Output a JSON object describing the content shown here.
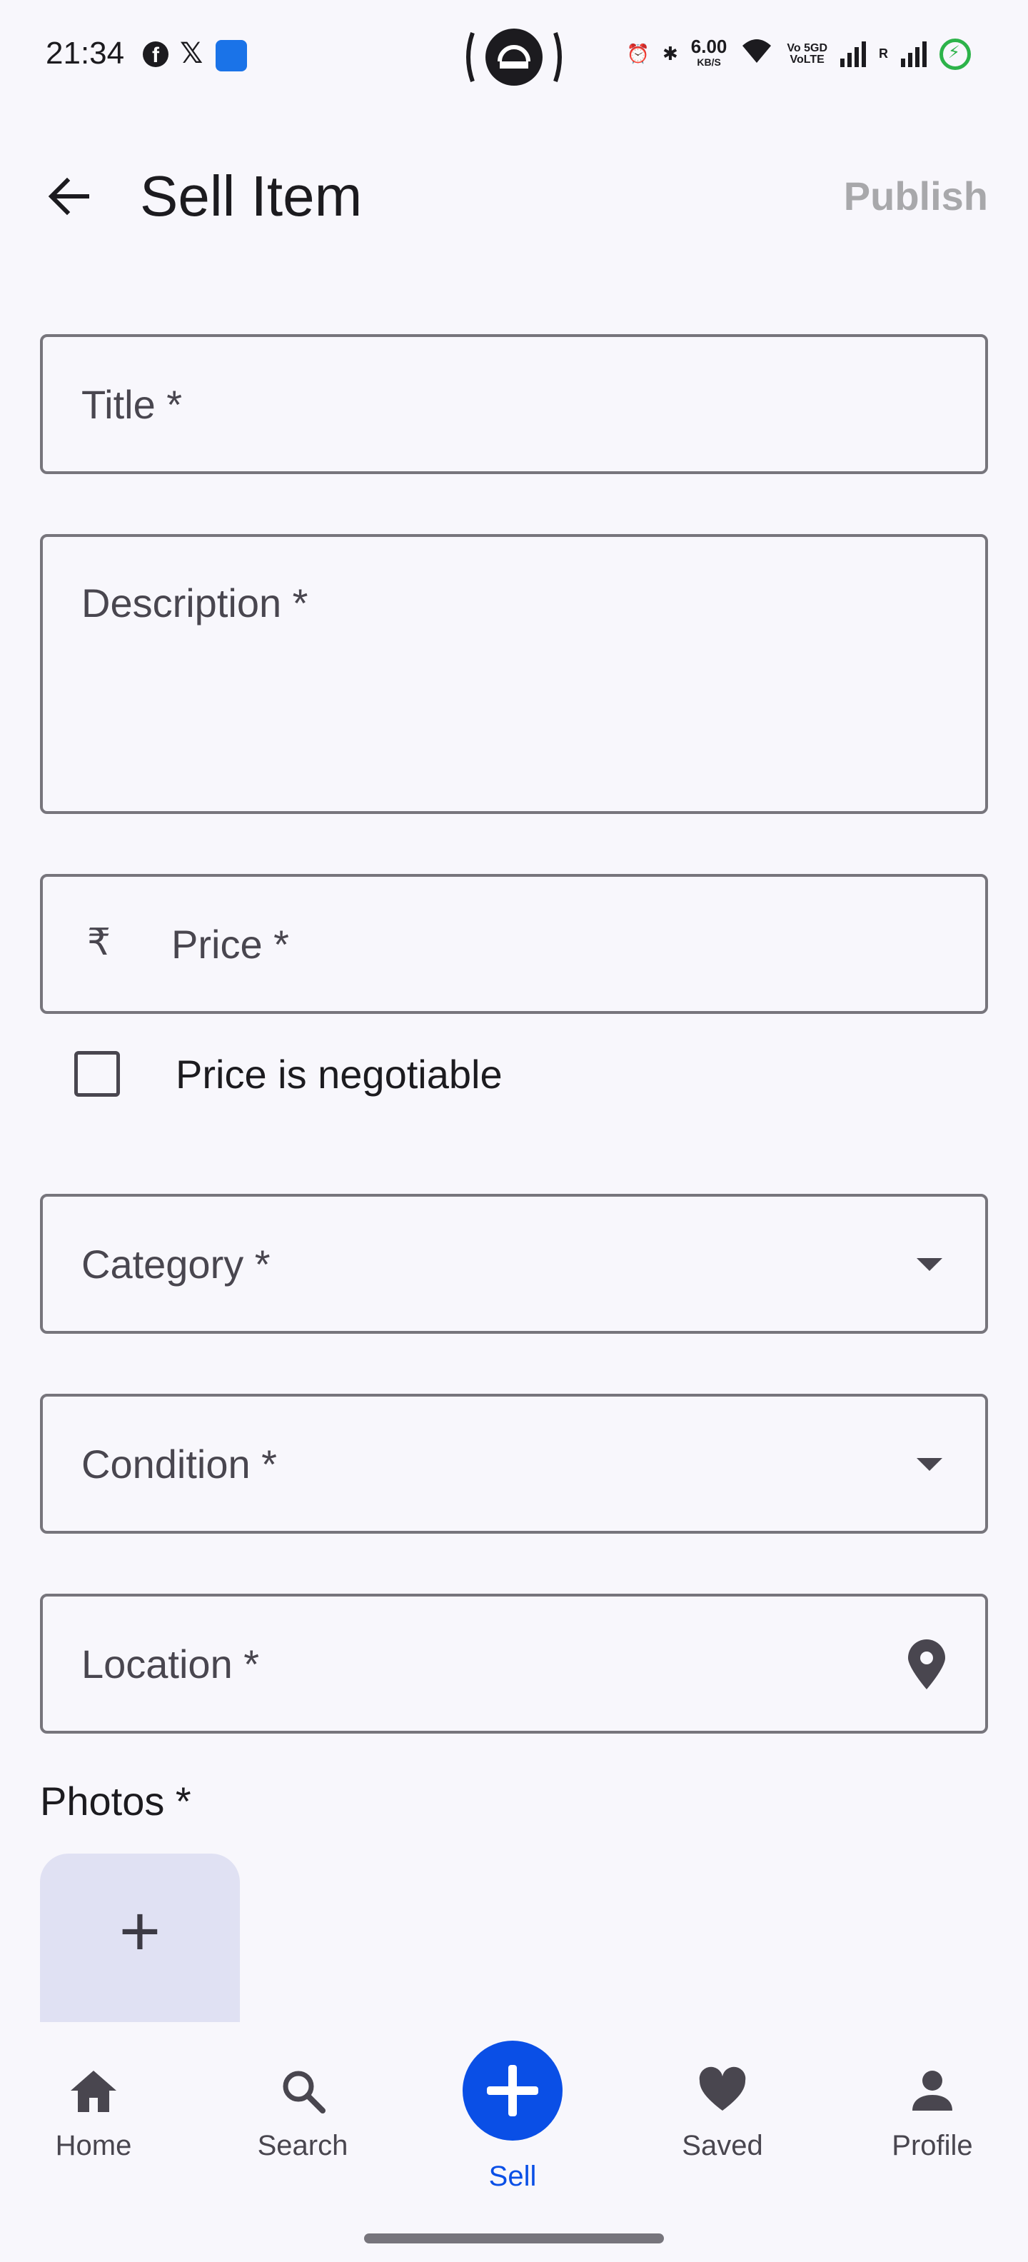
{
  "status_bar": {
    "time": "21:34",
    "speed_value": "6.00",
    "speed_unit": "KB/S",
    "volte_line1": "Vo 5GD",
    "volte_line2": "VoLTE",
    "roaming_label": "R"
  },
  "appbar": {
    "title": "Sell Item",
    "publish_label": "Publish"
  },
  "form": {
    "title_placeholder": "Title *",
    "description_placeholder": "Description *",
    "currency_symbol": "₹",
    "price_placeholder": "Price *",
    "negotiable_label": "Price is negotiable",
    "category_placeholder": "Category *",
    "condition_placeholder": "Condition *",
    "location_placeholder": "Location *",
    "photos_label": "Photos *",
    "add_photo_symbol": "+"
  },
  "bottom_nav": {
    "items": [
      {
        "label": "Home",
        "icon": "home-icon"
      },
      {
        "label": "Search",
        "icon": "search-icon"
      },
      {
        "label": "Sell",
        "icon": "add-icon",
        "active": true
      },
      {
        "label": "Saved",
        "icon": "heart-icon"
      },
      {
        "label": "Profile",
        "icon": "person-icon"
      }
    ]
  },
  "colors": {
    "accent": "#0a4fe6",
    "outline": "#77757c",
    "background": "#f8f7fc",
    "photo_tile": "#e0e1f3"
  }
}
